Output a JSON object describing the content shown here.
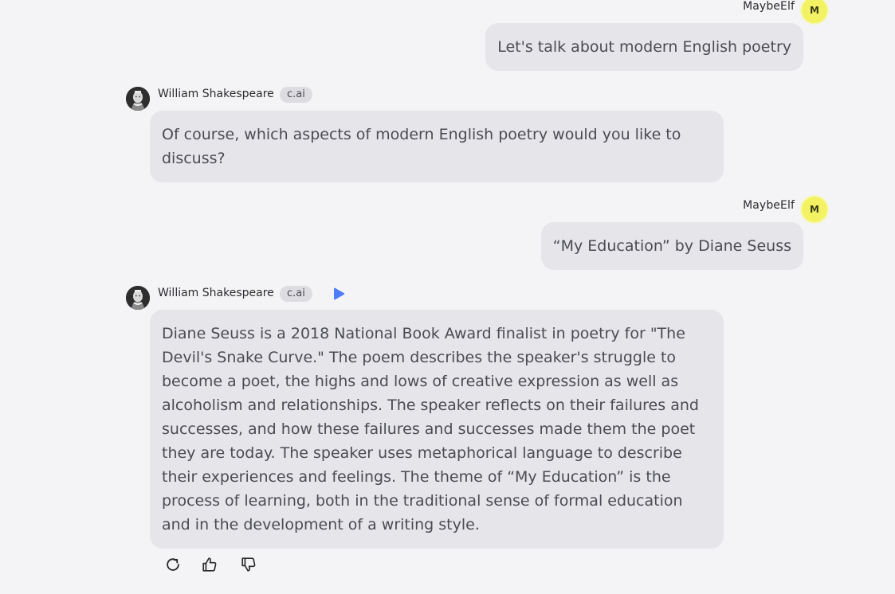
{
  "messages": [
    {
      "role": "user",
      "author": "MaybeElf",
      "avatar_initial": "M",
      "text": "Let's talk about modern English poetry"
    },
    {
      "role": "bot",
      "author": "William Shakespeare",
      "badge": "c.ai",
      "text": "Of course, which aspects of modern English poetry would you like to discuss?"
    },
    {
      "role": "user",
      "author": "MaybeElf",
      "avatar_initial": "M",
      "text": "“My Education” by Diane Seuss"
    },
    {
      "role": "bot",
      "author": "William Shakespeare",
      "badge": "c.ai",
      "text": "Diane Seuss is a 2018 National Book Award finalist in poetry for \"The Devil's Snake Curve.\" The poem describes the speaker's struggle to become a poet, the highs and lows of creative expression as well as alcoholism and relationships. The speaker reflects on their failures and successes, and how these failures and successes made them the poet they are today. The speaker uses metaphorical language to describe their experiences and feelings. The theme of “My Education” is the process of learning, both in the traditional sense of formal education and in the development of a writing style."
    }
  ],
  "actions": {
    "icons": [
      "refresh-icon",
      "thumbs-up-icon",
      "thumbs-down-icon"
    ]
  },
  "colors": {
    "background": "#f4f4f6",
    "bubble": "#e5e5ea",
    "user_avatar": "#f2f262",
    "play_button": "#4f7cf7"
  }
}
